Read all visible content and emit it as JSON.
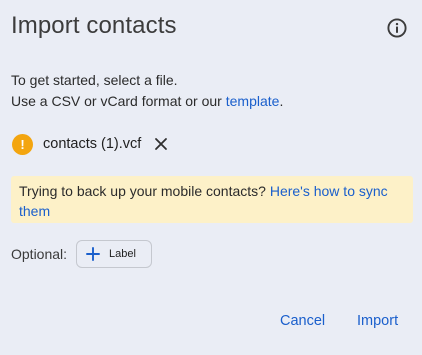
{
  "dialog": {
    "title": "Import contacts",
    "info_icon": "info-icon"
  },
  "description": {
    "line1": "To get started, select a file.",
    "line2_prefix": "Use a CSV or vCard format or our ",
    "line2_link": "template",
    "line2_suffix": "."
  },
  "file": {
    "status_icon": "warning-icon",
    "status_glyph": "!",
    "name": "contacts (1).vcf",
    "remove_icon": "close-icon"
  },
  "banner": {
    "text": "Trying to back up your mobile contacts? ",
    "link": "Here's how to sync them"
  },
  "optional": {
    "label": "Optional:",
    "chip_icon": "plus-icon",
    "chip_label": "Label"
  },
  "actions": {
    "cancel_label": "Cancel",
    "import_label": "Import"
  },
  "colors": {
    "background": "#eaedf5",
    "accent": "#1a5fcc",
    "warning": "#f3a50f",
    "banner_bg": "#fdf1c8"
  }
}
